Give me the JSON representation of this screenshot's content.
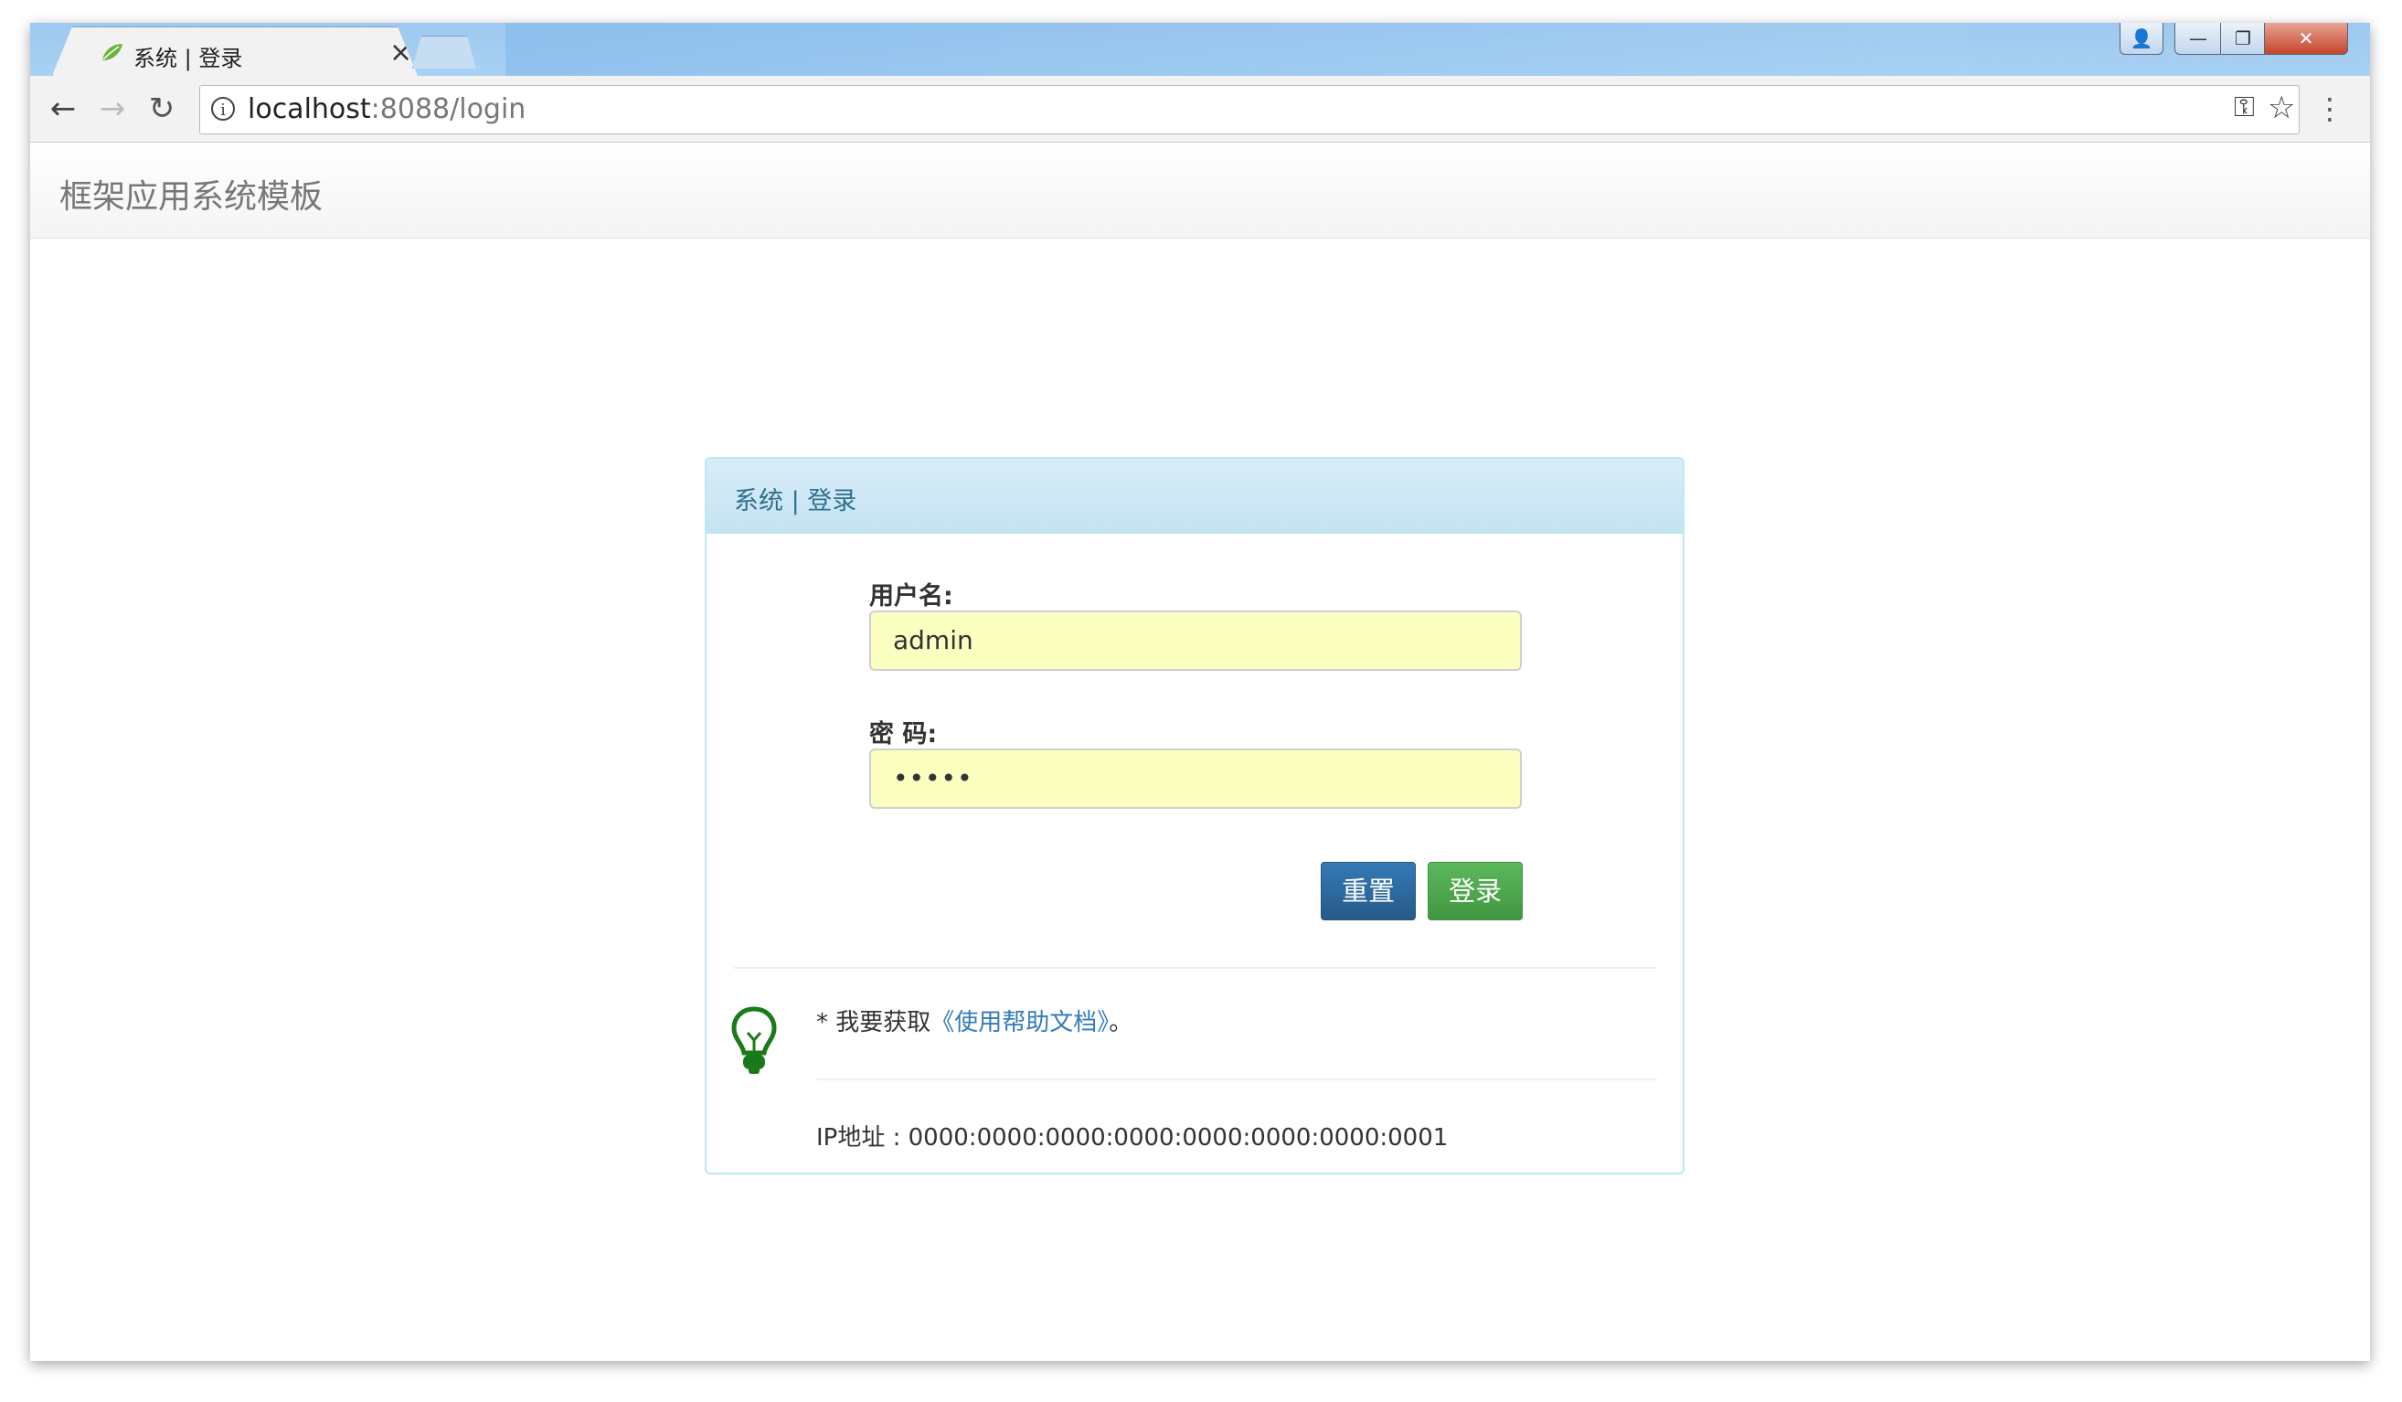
{
  "browser": {
    "tab_title": "系统 | 登录",
    "tab_close": "×",
    "url_host": "localhost",
    "url_rest": ":8088/login",
    "nav_back": "←",
    "nav_forward": "→",
    "nav_reload": "↻",
    "info_glyph": "i",
    "key_glyph": "⚿",
    "star_glyph": "☆",
    "menu_glyph": "⋮",
    "win_min": "—",
    "win_max": "❐",
    "win_close": "✕",
    "win_profile": "👤"
  },
  "navbar": {
    "brand": "框架应用系统模板"
  },
  "login": {
    "panel_title": "系统 | 登录",
    "username_label": "用户名:",
    "username_value": "admin",
    "password_label": "密 码:",
    "password_value": "•••••",
    "reset_label": "重置",
    "login_label": "登录",
    "tip_prefix": "* 我要获取",
    "tip_link": "《使用帮助文档》",
    "tip_suffix": "。",
    "ip_text": "IP地址 : 0000:0000:0000:0000:0000:0000:0000:0001"
  },
  "colors": {
    "panel_heading": "#d9edf7",
    "panel_title": "#31708f",
    "input_autofill": "#fbffc0",
    "btn_primary": "#337ab7",
    "btn_success": "#5cb85c",
    "bulb": "#1a7a1a"
  }
}
